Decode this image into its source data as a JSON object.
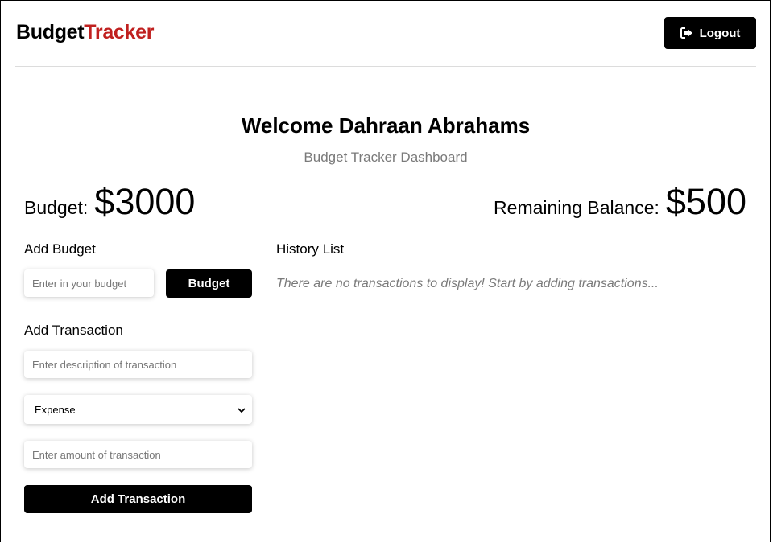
{
  "header": {
    "brand_part1": "Budget",
    "brand_part2": "Tracker",
    "logout_label": "Logout"
  },
  "welcome": {
    "title": "Welcome Dahraan Abrahams",
    "subtitle": "Budget Tracker Dashboard"
  },
  "summary": {
    "budget_label": "Budget:",
    "budget_value": "$3000",
    "remaining_label": "Remaining Balance:",
    "remaining_value": "$500"
  },
  "add_budget": {
    "title": "Add Budget",
    "input_placeholder": "Enter in your budget",
    "button_label": "Budget"
  },
  "add_transaction": {
    "title": "Add Transaction",
    "description_placeholder": "Enter description of transaction",
    "type_selected": "Expense",
    "amount_placeholder": "Enter amount of transaction",
    "button_label": "Add Transaction"
  },
  "history": {
    "title": "History List",
    "empty_message": "There are no transactions to display! Start by adding transactions..."
  },
  "colors": {
    "brand_accent": "#c0201f",
    "button_bg": "#000000",
    "muted_text": "#7a7a7a"
  },
  "icons": {
    "logout": "sign-out-icon",
    "select": "chevron-down-icon"
  }
}
